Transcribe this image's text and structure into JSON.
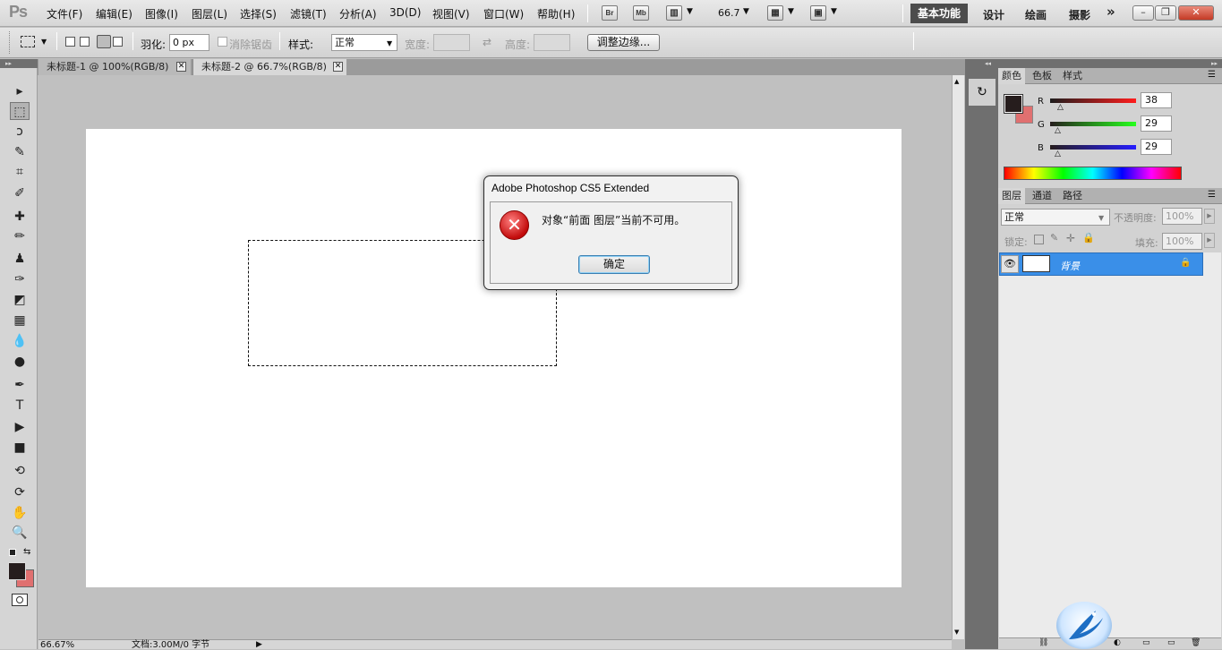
{
  "app": {
    "logo": "Ps"
  },
  "menu": [
    "文件(F)",
    "编辑(E)",
    "图像(I)",
    "图层(L)",
    "选择(S)",
    "滤镜(T)",
    "分析(A)",
    "3D(D)",
    "视图(V)",
    "窗口(W)",
    "帮助(H)"
  ],
  "menubar_buttons": {
    "bridge": "Br",
    "mini_bridge": "Mb",
    "zoom_value": "66.7"
  },
  "workspaces": {
    "active": "基本功能",
    "design": "设计",
    "painting": "绘画",
    "photography": "摄影",
    "more": "»"
  },
  "window_controls": {
    "minimize": "–",
    "restore": "❐",
    "close": "✕"
  },
  "options_bar": {
    "feather_label": "羽化:",
    "feather_value": "0 px",
    "antialias_label": "消除锯齿",
    "style_label": "样式:",
    "style_value": "正常",
    "width_label": "宽度:",
    "height_label": "高度:",
    "refine_edge": "调整边缘..."
  },
  "tabs": [
    {
      "label": "未标题-1 @ 100%(RGB/8)"
    },
    {
      "label": "未标题-2 @ 66.7%(RGB/8)"
    }
  ],
  "tools": [
    "move-tool",
    "marquee-tool",
    "lasso-tool",
    "quick-select-tool",
    "crop-tool",
    "eyedropper-tool",
    "healing-tool",
    "brush-tool",
    "clone-stamp-tool",
    "history-brush-tool",
    "eraser-tool",
    "gradient-tool",
    "blur-tool",
    "dodge-tool",
    "pen-tool",
    "type-tool",
    "path-select-tool",
    "shape-tool",
    "3d-rotate-tool",
    "3d-orbit-tool",
    "hand-tool",
    "zoom-tool"
  ],
  "tool_glyphs": [
    "▸",
    "⬚",
    "ↄ",
    "✎",
    "⌗",
    "✐",
    "✚",
    "✏",
    "♟",
    "✑",
    "◩",
    "▦",
    "💧",
    "●",
    "✒",
    "T",
    "▶",
    "■",
    "⟲",
    "⟳",
    "✋",
    "🔍"
  ],
  "status": {
    "zoom": "66.67%",
    "doc": "文档:3.00M/0 字节"
  },
  "color_panel": {
    "tabs": [
      "颜色",
      "色板",
      "样式"
    ],
    "r_label": "R",
    "g_label": "G",
    "b_label": "B",
    "r": "38",
    "g": "29",
    "b": "29",
    "foreground": "#261d1d",
    "background": "#e07070"
  },
  "layers_panel": {
    "tabs": [
      "图层",
      "通道",
      "路径"
    ],
    "blend_mode": "正常",
    "opacity_label": "不透明度:",
    "opacity_value": "100%",
    "lock_label": "锁定:",
    "fill_label": "填充:",
    "fill_value": "100%",
    "layer_name": "背景"
  },
  "dialog": {
    "title": "Adobe Photoshop CS5 Extended",
    "message": "对象“前面 图层”当前不可用。",
    "ok": "确定",
    "icon": "error-icon"
  }
}
